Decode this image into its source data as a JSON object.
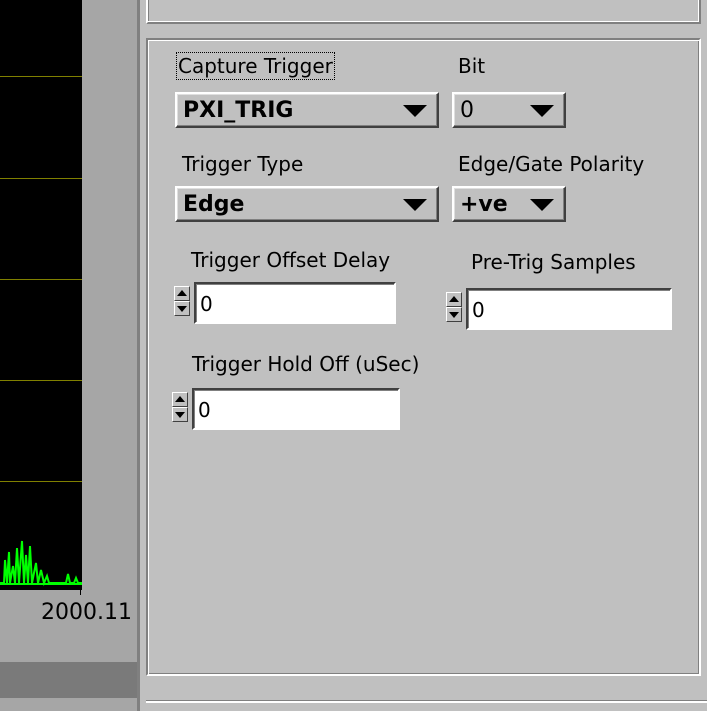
{
  "graph": {
    "x_tick_label": "2000.11",
    "colors": {
      "plot_bg": "#000000",
      "gridline": "#808000",
      "trace": "#00ff00"
    }
  },
  "trigger_panel": {
    "capture_trigger": {
      "label": "Capture Trigger",
      "value": "PXI_TRIG"
    },
    "bit": {
      "label": "Bit",
      "value": "0"
    },
    "trigger_type": {
      "label": "Trigger Type",
      "value": "Edge"
    },
    "edge_gate_polarity": {
      "label": "Edge/Gate Polarity",
      "value": "+ve"
    },
    "trigger_offset_delay": {
      "label": "Trigger Offset Delay",
      "value": "0"
    },
    "pre_trig_samples": {
      "label": "Pre-Trig Samples",
      "value": "0"
    },
    "trigger_hold_off": {
      "label": "Trigger Hold Off (uSec)",
      "value": "0"
    }
  },
  "icons": [
    "ring-dropdown-arrow-icon",
    "increment-arrow-icon",
    "decrement-arrow-icon"
  ]
}
